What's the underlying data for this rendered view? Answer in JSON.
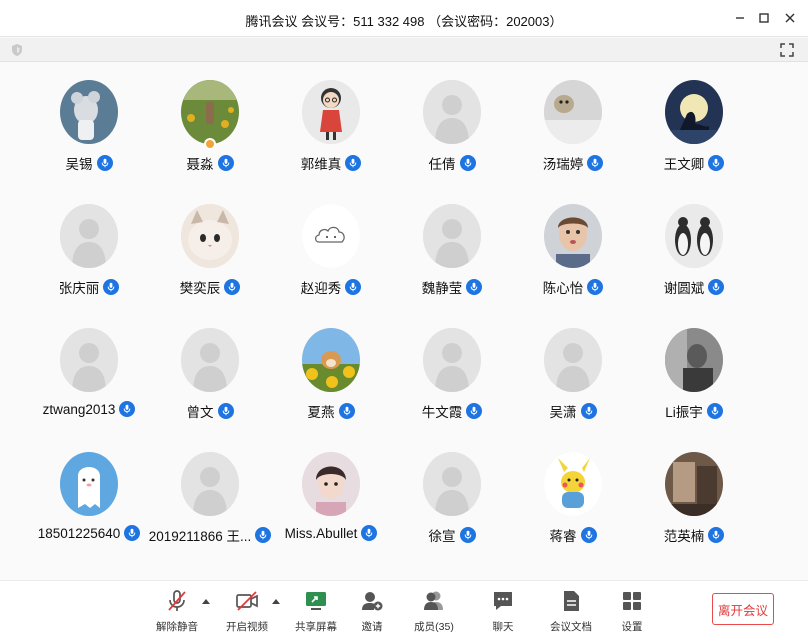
{
  "window": {
    "title": "腾讯会议 会议号：511 332 498 （会议密码：202003）"
  },
  "participants": [
    {
      "name": "吴锡",
      "avatar": "mouse-photo"
    },
    {
      "name": "聂淼",
      "avatar": "sunflower-field-photo",
      "host_badge": true
    },
    {
      "name": "郭维真",
      "avatar": "cartoon-girl"
    },
    {
      "name": "任倩",
      "avatar": "default-user"
    },
    {
      "name": "汤瑞婷",
      "avatar": "dog-photo"
    },
    {
      "name": "王文卿",
      "avatar": "mermaid-silhouette"
    },
    {
      "name": "张庆丽",
      "avatar": "default-user"
    },
    {
      "name": "樊奕辰",
      "avatar": "cat-photo"
    },
    {
      "name": "赵迎秀",
      "avatar": "cloud-emoji"
    },
    {
      "name": "魏静莹",
      "avatar": "default-user"
    },
    {
      "name": "陈心怡",
      "avatar": "child-photo"
    },
    {
      "name": "谢圆斌",
      "avatar": "penguins-photo"
    },
    {
      "name": "ztwang2013",
      "avatar": "default-user"
    },
    {
      "name": "曾文",
      "avatar": "default-user"
    },
    {
      "name": "夏燕",
      "avatar": "shiba-sunflower-photo"
    },
    {
      "name": "牛文霞",
      "avatar": "default-user"
    },
    {
      "name": "吴潇",
      "avatar": "default-user"
    },
    {
      "name": "Li振宇",
      "avatar": "portrait-photo"
    },
    {
      "name": "18501225640",
      "avatar": "ghost-cartoon"
    },
    {
      "name": "2019211866 王...",
      "avatar": "default-user"
    },
    {
      "name": "Miss.Abullet",
      "avatar": "girl-photo"
    },
    {
      "name": "徐宣",
      "avatar": "default-user"
    },
    {
      "name": "蒋睿",
      "avatar": "pikachu-cartoon"
    },
    {
      "name": "范英楠",
      "avatar": "room-photo"
    }
  ],
  "toolbar": {
    "unmute": "解除静音",
    "start_video": "开启视频",
    "share_screen": "共享屏幕",
    "invite": "邀请",
    "members": "成员(35)",
    "chat": "聊天",
    "documents": "会议文档",
    "settings": "设置",
    "leave": "离开会议"
  },
  "colors": {
    "mic_badge": "#1e74e0",
    "leave_button": "#e23a3a",
    "share_screen_icon": "#2f8f4e"
  }
}
